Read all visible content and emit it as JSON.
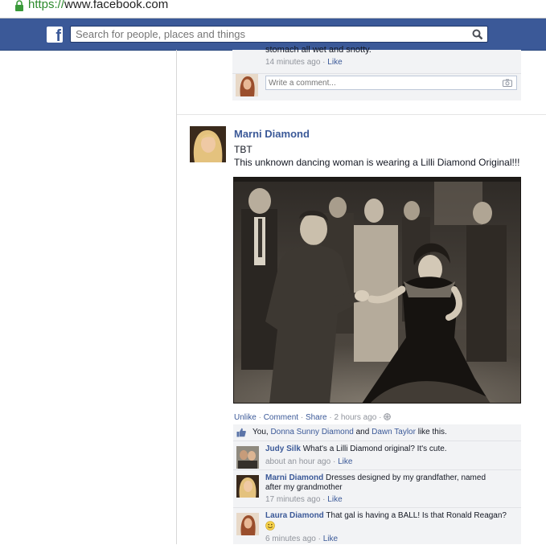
{
  "browser": {
    "url_protocol": "https://",
    "url_host": "www.facebook.com"
  },
  "header": {
    "search_placeholder": "Search for people, places and things",
    "brand_color": "#3b5998"
  },
  "previous_post": {
    "comment_text_fragment": "stomach all wet and snotty.",
    "comment_time": "14 minutes ago",
    "like_label": "Like",
    "write_comment_placeholder": "Write a comment..."
  },
  "post": {
    "author": "Marni Diamond",
    "line1": "TBT",
    "line2": "This unknown dancing woman is wearing a Lilli Diamond Original!!!",
    "actions": {
      "unlike": "Unlike",
      "comment": "Comment",
      "share": "Share",
      "time": "2 hours ago"
    },
    "likes": {
      "prefix": "You, ",
      "person1": "Donna Sunny Diamond",
      "and": " and ",
      "person2": "Dawn Taylor",
      "suffix": " like this."
    },
    "comments": [
      {
        "name": "Judy Silk",
        "text": "What's a Lilli Diamond original? It's cute.",
        "time": "about an hour ago",
        "like": "Like"
      },
      {
        "name": "Marni Diamond",
        "text": "Dresses designed by my grandfather, named after my grandmother",
        "time": "17 minutes ago",
        "like": "Like"
      },
      {
        "name": "Laura Diamond",
        "text": "That gal is having a BALL! Is that Ronald Reagan?",
        "time": "6 minutes ago",
        "like": "Like"
      }
    ]
  }
}
